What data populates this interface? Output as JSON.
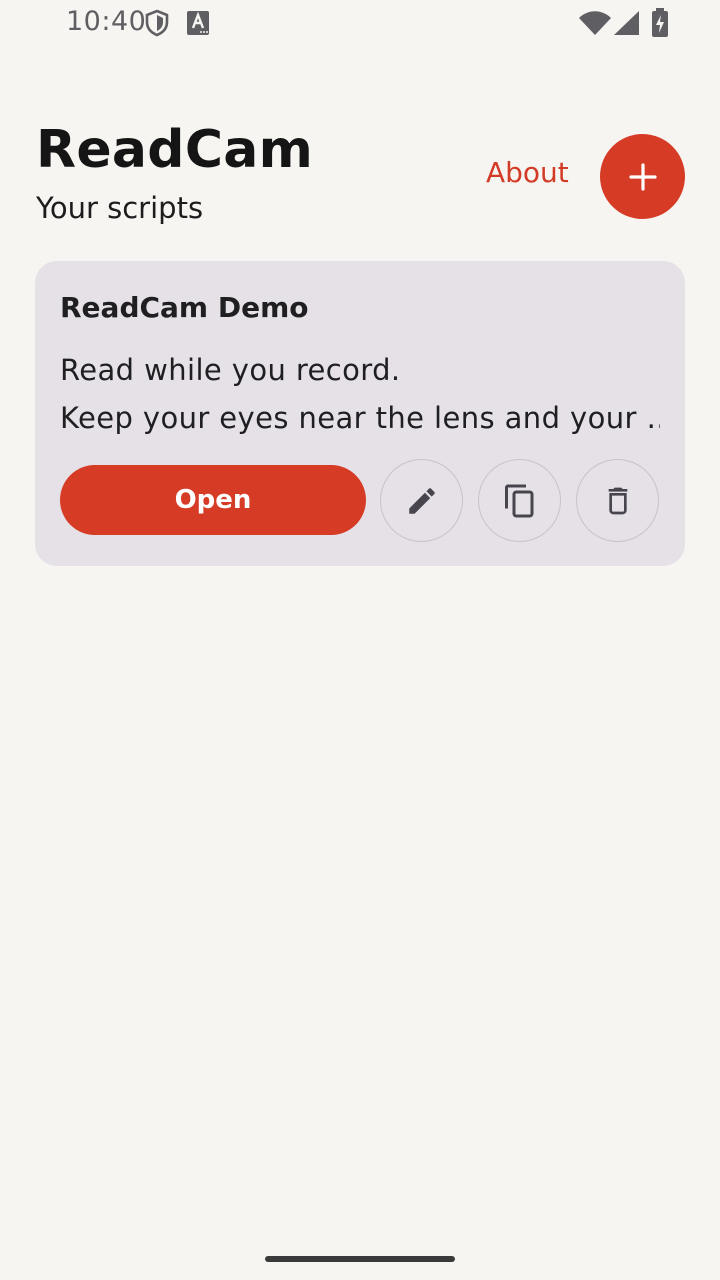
{
  "status_bar": {
    "time": "10:40",
    "icons": [
      "shield-icon",
      "a-text-icon",
      "wifi-icon",
      "signal-icon",
      "battery-charging-icon"
    ]
  },
  "header": {
    "title": "ReadCam",
    "subtitle": "Your scripts",
    "about_label": "About",
    "add_icon": "plus-icon"
  },
  "scripts": [
    {
      "title": "ReadCam Demo",
      "preview_line_1": "Read while you record.",
      "preview_line_2": "Keep your eyes near the lens and your …",
      "open_label": "Open",
      "actions": [
        "edit-icon",
        "copy-icon",
        "delete-icon"
      ]
    }
  ],
  "colors": {
    "accent": "#d63b26",
    "background": "#f7f5f2",
    "card": "#e5e1e7"
  }
}
